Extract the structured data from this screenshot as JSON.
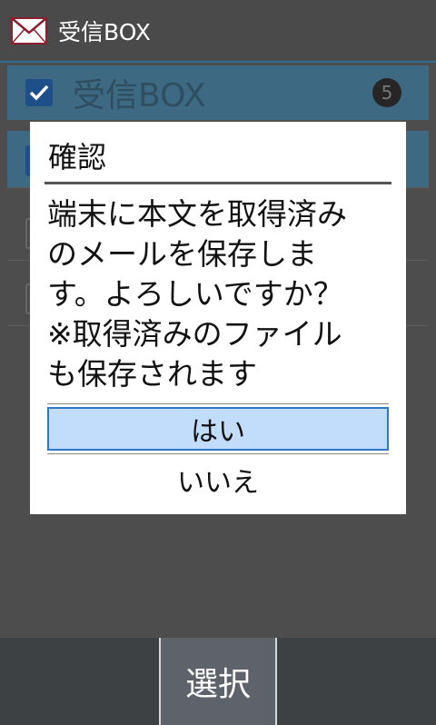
{
  "header": {
    "title": "受信BOX",
    "icon": "mail-icon"
  },
  "folder": {
    "name": "受信BOX",
    "count": "5",
    "checked": true
  },
  "rows": [
    {
      "selected": true
    },
    {
      "selected": false
    },
    {
      "selected": false
    }
  ],
  "dialog": {
    "title": "確認",
    "message": "端末に本文を取得済み\nのメールを保存しま\nす。よろしいですか？\n※取得済みのファイル\nも保存されます",
    "yes_label": "はい",
    "no_label": "いいえ"
  },
  "bottom_bar": {
    "select_label": "選択"
  },
  "colors": {
    "accent": "#2f78c8",
    "selected_fill": "#c2dcfb"
  }
}
